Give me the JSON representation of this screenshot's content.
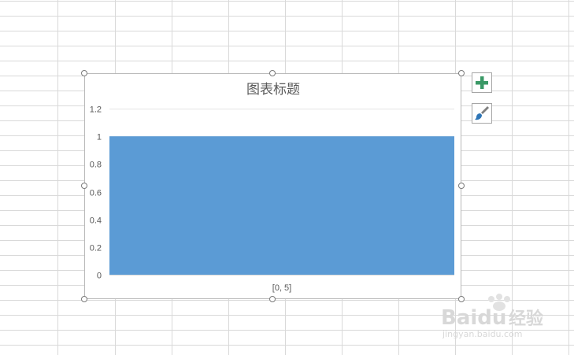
{
  "chart_data": {
    "type": "bar",
    "title": "图表标题",
    "categories": [
      "[0, 5]"
    ],
    "series": [
      {
        "values": [
          1
        ],
        "color": "#5b9bd5"
      }
    ],
    "ylim": [
      0,
      1.2
    ],
    "yticks": [
      "0",
      "0.2",
      "0.4",
      "0.6",
      "0.8",
      "1",
      "1.2"
    ],
    "grid": true,
    "legend": "none"
  },
  "chart_elements_button_icon": "plus-icon",
  "chart_styles_button_icon": "paintbrush-icon",
  "watermark": {
    "brand": "Baidu",
    "sub": "经验",
    "url": "jingyan.baidu.com"
  }
}
